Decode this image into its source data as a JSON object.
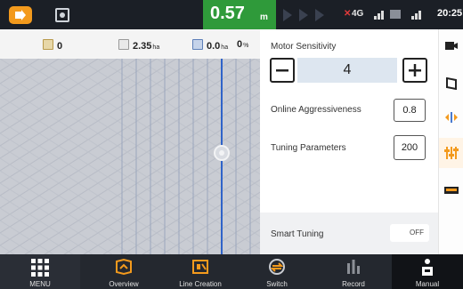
{
  "statusbar": {
    "deviation_value": "0.57",
    "deviation_unit": "m",
    "network_label": "4G",
    "time": "20:25"
  },
  "info": {
    "item1": "0",
    "item2_value": "2.35",
    "item2_unit": "ha",
    "item3_value": "0.0",
    "item3_unit": "ha",
    "item4_value": "0",
    "item4_unit": "%"
  },
  "panel": {
    "motor_sensitivity_label": "Motor Sensitivity",
    "motor_sensitivity_value": "4",
    "online_aggressiveness_label": "Online Aggressiveness",
    "online_aggressiveness_value": "0.8",
    "tuning_parameters_label": "Tuning Parameters",
    "tuning_parameters_value": "200",
    "smart_tuning_label": "Smart Tuning",
    "smart_tuning_state": "OFF"
  },
  "nav": {
    "menu": "MENU",
    "overview": "Overview",
    "line_creation": "Line Creation",
    "switch": "Switch",
    "record": "Record",
    "manual": "Manual"
  },
  "colors": {
    "accent": "#f39a1d",
    "deviation_bg": "#2f9a3a",
    "guide_line": "#2f63c9"
  },
  "icons": [
    "home-icon",
    "satellite-icon",
    "direction-arrows-icon",
    "signal-icon",
    "camera-icon",
    "field-boundary-icon",
    "alignment-icon",
    "sliders-icon",
    "implement-icon",
    "grid-menu-icon",
    "overview-icon",
    "line-creation-icon",
    "switch-icon",
    "record-icon",
    "manual-icon",
    "tractor-icon"
  ]
}
